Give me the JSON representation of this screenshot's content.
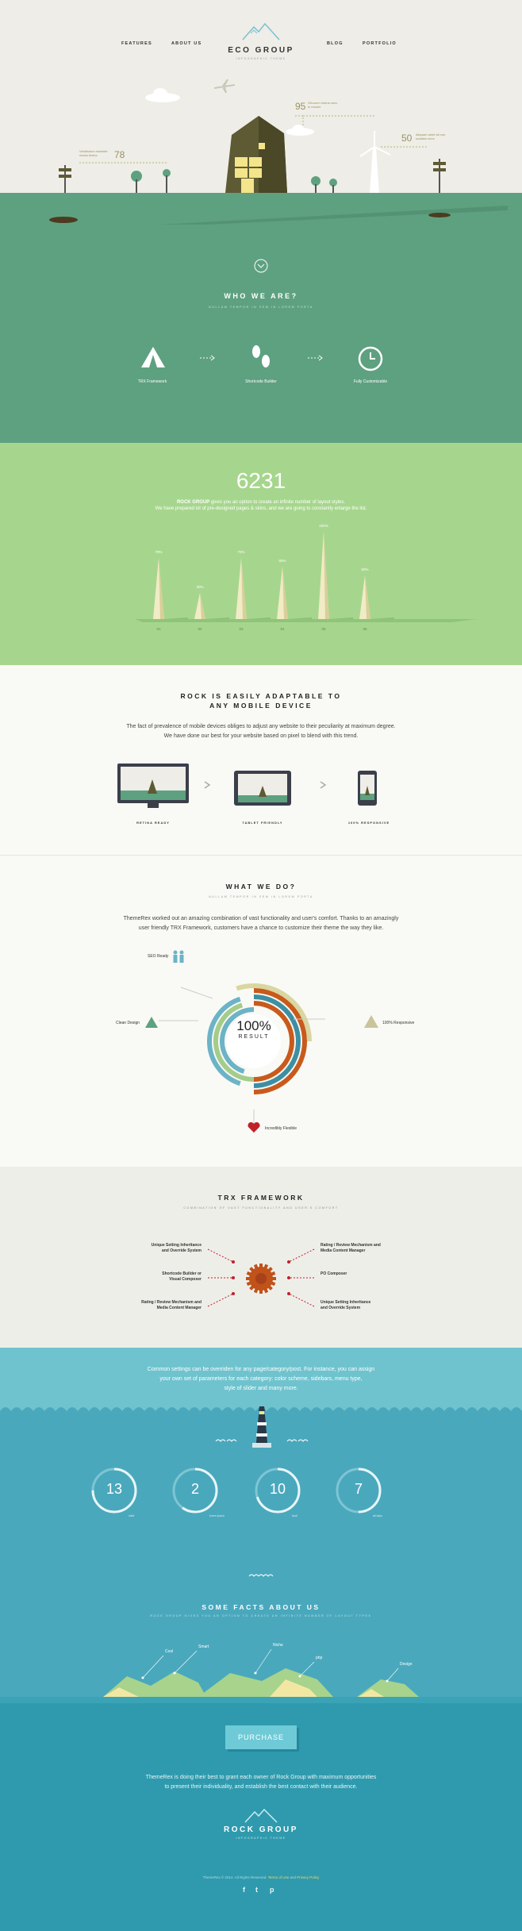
{
  "nav": {
    "left": [
      "FEATURES",
      "ABOUT US"
    ],
    "right": [
      "BLOG",
      "PORTFOLIO"
    ],
    "logo_title": "ECO GROUP",
    "logo_sub": "INFOGRAPHIC THEME"
  },
  "hero_stats": [
    {
      "num": "95",
      "text": "Ofuurum metus nunc in mauris"
    },
    {
      "num": "78",
      "text": "Vestibulum molestie metus lectus"
    },
    {
      "num": "50",
      "text": "Aliquam amet sit non sodales nunc"
    }
  ],
  "who": {
    "title": "WHO WE ARE?",
    "subtitle": "NULLAM TEMPOR IN SEM IN LOREM PORTA",
    "features": [
      "TRX Framework",
      "Shortcode Builder",
      "Fully Customizable"
    ]
  },
  "stats": {
    "number": "6231",
    "line1_bold": "ROCK GROUP",
    "line1": " gives you an option to create an infinite number of layout styles.",
    "line2": "We have prepared lot of  pre-designed pages & skins, and we are going to constantly enlarge the list."
  },
  "chart_data": {
    "type": "bar",
    "categories": [
      "01",
      "02",
      "03",
      "04",
      "05",
      "06"
    ],
    "series": [
      {
        "values": [
          7,
          3,
          7,
          6,
          10,
          5
        ]
      }
    ],
    "peak_labels": [
      "70%",
      "30%",
      "70%",
      "60%",
      "100%",
      "50%"
    ]
  },
  "mobile": {
    "title_line1": "ROCK IS EASILY ADAPTABLE TO",
    "title_line2": "ANY MOBILE DEVICE",
    "text1": "The fact of prevalence of mobile devices obliges to adjust any website to their peculiarity at maximum degree.",
    "text2": "We have done our best for your website based on pixel to blend with this trend.",
    "devices": [
      "RETINA READY",
      "TABLET FRIENDLY",
      "100% RESPONSIVE"
    ]
  },
  "what": {
    "title": "WHAT WE DO?",
    "subtitle": "NULLAM TEMPOR IN SEM IN LOREM PORTA",
    "text1": "ThemeRex worked out an amazing combination of vast functionality and user's comfort. Thanks to an amazingly",
    "text2": "user friendly TRX Framework, customers have a chance to customize their theme the way they like.",
    "center_num": "100%",
    "center_label": "RESULT",
    "labels": [
      "SEO Ready",
      "Clean Design",
      "100% Responsive",
      "Incredibly Flexible"
    ]
  },
  "trx": {
    "title": "TRX FRAMEWORK",
    "subtitle": "COMBINATION OF VAST FUNCTIONALITY AND USER'S COMFORT",
    "left": [
      [
        "Unique Setting Inheritance",
        "and Override System"
      ],
      [
        "Shortcode Builder or",
        "Visual Composer"
      ],
      [
        "Rating / Review Mechanism and",
        "Media Content Manager"
      ]
    ],
    "right": [
      [
        "Rating / Review Mechanism and",
        "Media Content Manager"
      ],
      [
        "PO Composer"
      ],
      [
        "Unique Setting Inheritance",
        "and Override System"
      ]
    ]
  },
  "sea": {
    "text1": "Common settings can be overriden for any page/category/post. For instance, you can assign",
    "text2": "your own set of parameters for each category: color scheme, sidebars, menu type,",
    "text3": "style of slider and many more.",
    "circles": [
      {
        "num": "13",
        "cap": "nisid",
        "pct": 0.75
      },
      {
        "num": "2",
        "cap": "lorem ipsum",
        "pct": 0.6
      },
      {
        "num": "10",
        "cap": "fault",
        "pct": 0.7
      },
      {
        "num": "7",
        "cap": "all days",
        "pct": 0.5
      }
    ],
    "facts_title": "SOME FACTS ABOUT US",
    "facts_sub": "ROCK GROUP GIVES YOU AN OPTION TO CREATE AN INFINITE NUMBER OF LAYOUT TYPES",
    "islands": [
      "Cool",
      "Smart",
      "Niche",
      "php",
      "Design"
    ]
  },
  "footer": {
    "purchase": "PURCHASE",
    "text1": "ThemeRex is doing their best to grant each owner of Rock Group with maximum opportunities",
    "text2": "to present their individuality, and establish the best contact with their audience.",
    "logo_title": "ROCK GROUP",
    "logo_sub": "INFOGRAPHIC THEME",
    "copyright": "ThemeRex © 2014. All Rights Reserved.",
    "terms": "Terms of Use",
    "and": " and ",
    "privacy": "Privacy Policy",
    "social_icons": [
      "facebook-icon",
      "twitter-icon",
      "pinterest-icon"
    ],
    "social_glyphs": [
      "f",
      "t",
      "p"
    ]
  },
  "colors": {
    "ground": "#5ea180",
    "stats_bg": "#a6d68d",
    "sea": "#4aa8bd",
    "footer": "#2f9aad",
    "ring": [
      "#c85a1c",
      "#6cb3c7",
      "#d9d6a0",
      "#3d8fa2",
      "#a4cc8a"
    ]
  }
}
